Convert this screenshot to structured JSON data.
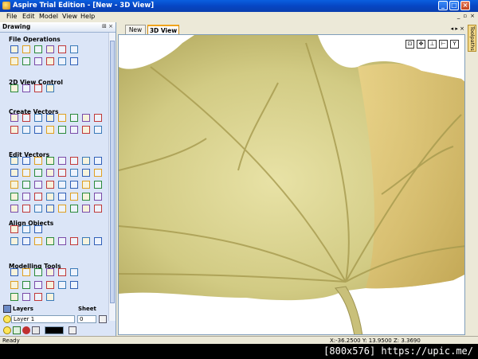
{
  "window": {
    "title": "Aspire Trial Edition - [New - 3D View]"
  },
  "menu": [
    "File",
    "Edit",
    "Model",
    "View",
    "Help"
  ],
  "panel": {
    "title": "Drawing",
    "sections": [
      "File Operations",
      "2D View Control",
      "Create Vectors",
      "Edit Vectors",
      "Align Objects",
      "Modelling Tools"
    ],
    "layers_label": "Layers",
    "sheet_label": "Sheet",
    "layer_value": "Layer 1",
    "sheet_value": "0"
  },
  "tabs": [
    "New",
    "3D View"
  ],
  "side_tab": "Toolpaths",
  "status": {
    "left": "Ready",
    "coords": "X:-36.2500 Y: 13.9500 Z: 3.3690"
  },
  "watermark": "[800x576] https://upic.me/",
  "colors": {
    "leaf": "#d8d290",
    "view_bg": "#ffffff",
    "panel_bg": "#dbe5f7",
    "title_bar": "#0646c4"
  }
}
